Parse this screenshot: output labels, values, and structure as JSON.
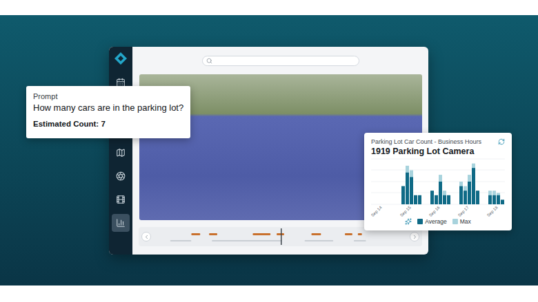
{
  "sidebar": {
    "items": [
      {
        "selected": false
      },
      {
        "selected": false
      },
      {
        "selected": false
      },
      {
        "selected": false
      },
      {
        "selected": false
      },
      {
        "selected": false
      },
      {
        "selected": true
      }
    ]
  },
  "prompt_card": {
    "label": "Prompt",
    "question": "How many cars are in the parking lot?",
    "result": "Estimated Count: 7"
  },
  "chart_card": {
    "title": "Parking Lot Car Count - Business Hours",
    "camera": "1919 Parking Lot Camera",
    "days": [
      {
        "label": "Sep 14",
        "average": [],
        "max": []
      },
      {
        "label": "Sep 15",
        "average": [
          4,
          7,
          6,
          2,
          2
        ],
        "max": [
          4,
          8.5,
          7.5,
          2,
          2
        ]
      },
      {
        "label": "Sep 16",
        "average": [
          3,
          2,
          5,
          2,
          2
        ],
        "max": [
          3,
          2,
          6.5,
          3,
          2
        ]
      },
      {
        "label": "Sep 17",
        "average": [
          4,
          3,
          5,
          8,
          3
        ],
        "max": [
          5,
          4,
          6.5,
          9,
          3
        ]
      },
      {
        "label": "Sep 18",
        "average": [
          2,
          2,
          2,
          1
        ],
        "max": [
          3,
          3,
          2.5,
          1
        ]
      }
    ],
    "legend": [
      {
        "label": "Average",
        "color": "#0f6a86"
      },
      {
        "label": "Max",
        "color": "#a8d3dd"
      }
    ]
  }
}
